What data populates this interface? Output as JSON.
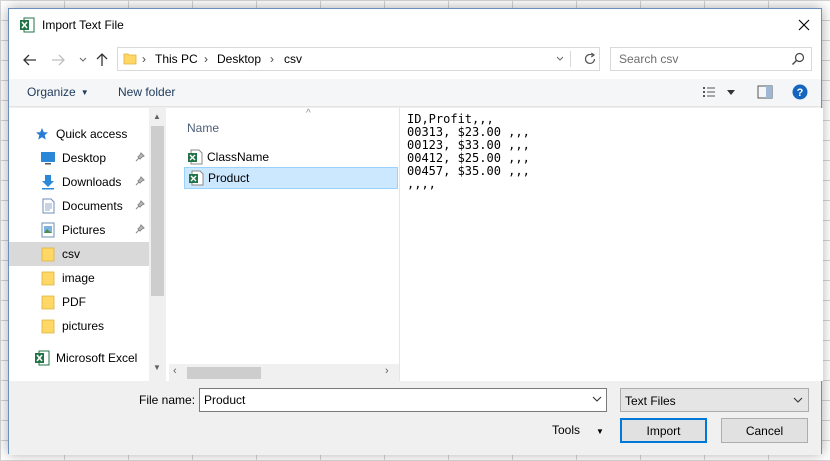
{
  "window": {
    "title": "Import Text File",
    "icon": "excel-icon"
  },
  "nav": {
    "breadcrumbs": [
      "This PC",
      "Desktop",
      "csv"
    ],
    "search_placeholder": "Search csv"
  },
  "toolbar": {
    "organize_label": "Organize",
    "new_folder_label": "New folder"
  },
  "sidebar": {
    "items": [
      {
        "label": "Quick access",
        "icon": "star-icon"
      },
      {
        "label": "Desktop",
        "icon": "desktop-icon",
        "pinned": true
      },
      {
        "label": "Downloads",
        "icon": "download-icon",
        "pinned": true
      },
      {
        "label": "Documents",
        "icon": "documents-icon",
        "pinned": true
      },
      {
        "label": "Pictures",
        "icon": "pictures-icon",
        "pinned": true
      },
      {
        "label": "csv",
        "icon": "folder-icon",
        "selected": true
      },
      {
        "label": "image",
        "icon": "folder-icon"
      },
      {
        "label": "PDF",
        "icon": "folder-icon"
      },
      {
        "label": "pictures",
        "icon": "folder-icon"
      },
      {
        "label": "Microsoft Excel",
        "icon": "excel-icon"
      }
    ]
  },
  "filelist": {
    "column_header": "Name",
    "files": [
      {
        "name": "ClassName",
        "icon": "excel-csv-icon"
      },
      {
        "name": "Product",
        "icon": "excel-csv-icon",
        "selected": true
      }
    ]
  },
  "preview": {
    "lines": [
      "ID,Profit,,,",
      "00313, $23.00 ,,,",
      "00123, $33.00 ,,,",
      "00412, $25.00 ,,,",
      "00457, $35.00 ,,,",
      ",,,,"
    ]
  },
  "bottom": {
    "file_name_label": "File name:",
    "file_name_value": "Product",
    "file_type": "Text Files",
    "tools_label": "Tools",
    "import_label": "Import",
    "cancel_label": "Cancel"
  },
  "colors": {
    "excel_green": "#217346",
    "accent_blue": "#0078d7",
    "selection_blue": "#cce8ff",
    "folder_yellow": "#ffd766"
  }
}
